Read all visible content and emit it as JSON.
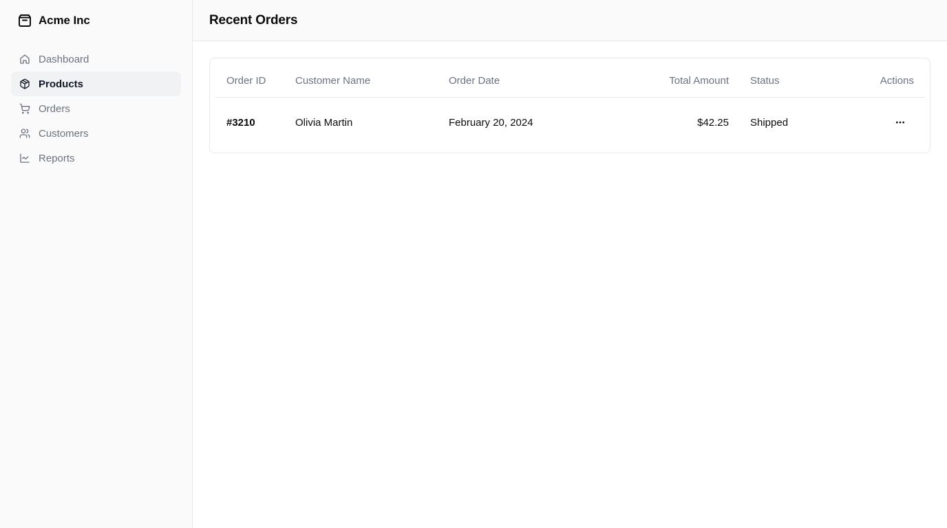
{
  "sidebar": {
    "brand": {
      "name": "Acme Inc",
      "icon": "package-icon"
    },
    "items": [
      {
        "label": "Dashboard",
        "icon": "home-icon",
        "active": false
      },
      {
        "label": "Products",
        "icon": "package-icon",
        "active": true
      },
      {
        "label": "Orders",
        "icon": "shopping-cart-icon",
        "active": false
      },
      {
        "label": "Customers",
        "icon": "users-icon",
        "active": false
      },
      {
        "label": "Reports",
        "icon": "line-chart-icon",
        "active": false
      }
    ]
  },
  "header": {
    "title": "Recent Orders"
  },
  "table": {
    "columns": [
      "Order ID",
      "Customer Name",
      "Order Date",
      "Total Amount",
      "Status",
      "Actions"
    ],
    "rows": [
      {
        "order_id": "#3210",
        "customer": "Olivia Martin",
        "date": "February 20, 2024",
        "amount": "$42.25",
        "status": "Shipped",
        "action_icon": "more-horizontal-icon"
      }
    ]
  },
  "colors": {
    "sidebar_bg": "#fafafa",
    "active_item_bg": "#f1f2f4",
    "muted_text": "#6b7280",
    "border": "#e5e7eb"
  }
}
